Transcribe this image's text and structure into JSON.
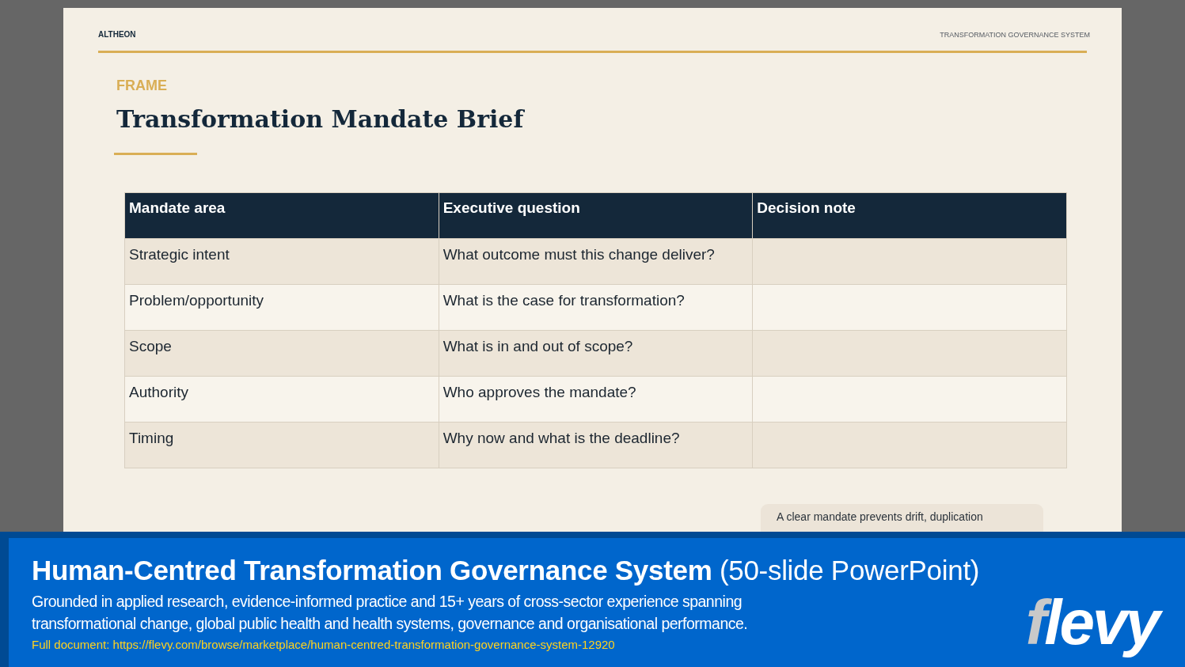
{
  "slide": {
    "brand": "ALTHEON",
    "header_title": "TRANSFORMATION GOVERNANCE SYSTEM",
    "eyebrow": "FRAME",
    "title": "Transformation Mandate Brief",
    "table": {
      "columns": [
        "Mandate area",
        "Executive question",
        "Decision note"
      ],
      "rows": [
        [
          "Strategic intent",
          "What outcome must this change deliver?",
          ""
        ],
        [
          "Problem/opportunity",
          "What is the case for transformation?",
          ""
        ],
        [
          "Scope",
          "What is in and out of scope?",
          ""
        ],
        [
          "Authority",
          "Who approves the mandate?",
          ""
        ],
        [
          "Timing",
          "Why now and what is the deadline?",
          ""
        ]
      ]
    },
    "callout": "A clear mandate prevents drift, duplication"
  },
  "banner": {
    "title": "Human-Centred Transformation Governance System",
    "title_suffix": "(50-slide PowerPoint)",
    "description": "Grounded in applied research, evidence-informed practice and 15+ years of cross-sector experience spanning transformational change, global public health and health systems, governance and organisational performance.",
    "link_label": "Full document:",
    "link": "https://flevy.com/browse/marketplace/human-centred-transformation-governance-system-12920",
    "logo_first": "f",
    "logo_rest": "levy"
  }
}
